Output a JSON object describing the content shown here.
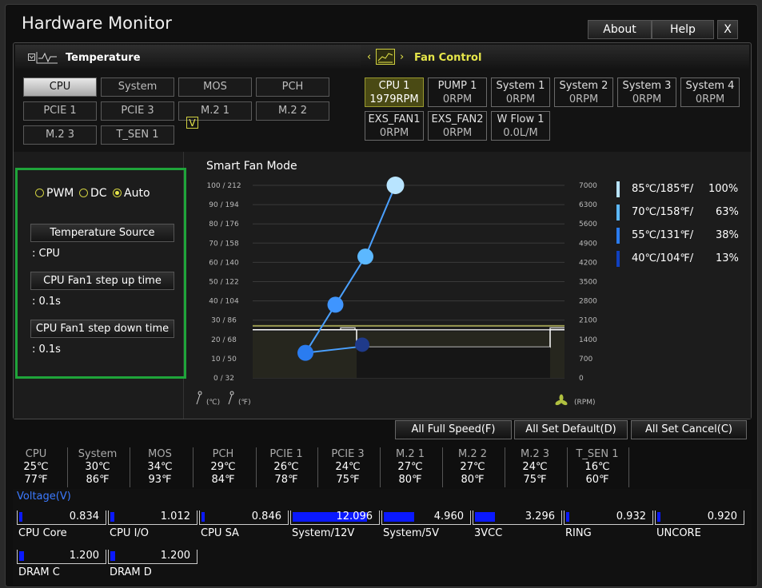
{
  "app": {
    "title": "Hardware Monitor",
    "buttons": {
      "about": "About",
      "help": "Help",
      "close": "X"
    }
  },
  "temperature_header": {
    "label": "Temperature"
  },
  "fan_header": {
    "label": "Fan Control"
  },
  "sources": [
    "CPU",
    "System",
    "MOS",
    "PCH",
    "PCIE 1",
    "PCIE 3",
    "M.2 1",
    "M.2 2",
    "M.2 3",
    "T_SEN 1"
  ],
  "fans": [
    {
      "name": "CPU 1",
      "value": "1979RPM"
    },
    {
      "name": "PUMP 1",
      "value": "0RPM"
    },
    {
      "name": "System 1",
      "value": "0RPM"
    },
    {
      "name": "System 2",
      "value": "0RPM"
    },
    {
      "name": "System 3",
      "value": "0RPM"
    },
    {
      "name": "System 4",
      "value": "0RPM"
    },
    {
      "name": "EXS_FAN1",
      "value": "0RPM"
    },
    {
      "name": "EXS_FAN2",
      "value": "0RPM"
    },
    {
      "name": "W Flow 1",
      "value": "0.0L/M"
    }
  ],
  "modes": {
    "pwm": "PWM",
    "dc": "DC",
    "auto": "Auto",
    "selected": "Auto"
  },
  "settings": {
    "temp_source_label": "Temperature Source",
    "temp_source_value": ": CPU",
    "step_up_label": "CPU Fan1 step up time",
    "step_up_value": ": 0.1s",
    "step_down_label": "CPU Fan1 step down time",
    "step_down_value": ": 0.1s"
  },
  "smart_fan": {
    "label": "Smart Fan Mode",
    "checked": true,
    "check_mark": "V"
  },
  "graph": {
    "left_ticks": [
      "100 / 212",
      "90 / 194",
      "80 / 176",
      "70 / 158",
      "60 / 140",
      "50 / 122",
      "40 / 104",
      "30 /  86",
      "20 /  68",
      "10 /  50",
      "0 /  32"
    ],
    "right_ticks": [
      "7000",
      "6300",
      "5600",
      "4900",
      "4200",
      "3500",
      "2800",
      "2100",
      "1400",
      "700",
      "0"
    ],
    "unit_c": "(℃)",
    "unit_f": "(℉)",
    "unit_rpm": "(RPM)",
    "points": [
      {
        "temp_c": 40,
        "pct": 13
      },
      {
        "temp_c": 55,
        "pct": 38
      },
      {
        "temp_c": 70,
        "pct": 63
      },
      {
        "temp_c": 85,
        "pct": 100
      }
    ]
  },
  "legend": [
    {
      "temp": "85℃/185℉/",
      "pct": "100%",
      "color": "#b8e4ff"
    },
    {
      "temp": "70℃/158℉/",
      "pct": "63%",
      "color": "#5cb8ff"
    },
    {
      "temp": "55℃/131℉/",
      "pct": "38%",
      "color": "#2a7cf0"
    },
    {
      "temp": "40℃/104℉/",
      "pct": "13%",
      "color": "#1040c0"
    }
  ],
  "actions": {
    "full_speed": "All Full Speed(F)",
    "set_default": "All Set Default(D)",
    "set_cancel": "All Set Cancel(C)"
  },
  "temps": [
    {
      "name": "CPU",
      "c": "25℃",
      "f": "77℉"
    },
    {
      "name": "System",
      "c": "30℃",
      "f": "86℉"
    },
    {
      "name": "MOS",
      "c": "34℃",
      "f": "93℉"
    },
    {
      "name": "PCH",
      "c": "29℃",
      "f": "84℉"
    },
    {
      "name": "PCIE 1",
      "c": "26℃",
      "f": "78℉"
    },
    {
      "name": "PCIE 3",
      "c": "24℃",
      "f": "75℉"
    },
    {
      "name": "M.2 1",
      "c": "27℃",
      "f": "80℉"
    },
    {
      "name": "M.2 2",
      "c": "27℃",
      "f": "80℉"
    },
    {
      "name": "M.2 3",
      "c": "24℃",
      "f": "75℉"
    },
    {
      "name": "T_SEN 1",
      "c": "16℃",
      "f": "60℉"
    }
  ],
  "voltage": {
    "title": "Voltage(V)",
    "items": [
      {
        "name": "CPU Core",
        "value": "0.834",
        "fill": 0.04
      },
      {
        "name": "CPU I/O",
        "value": "1.012",
        "fill": 0.05
      },
      {
        "name": "CPU SA",
        "value": "0.846",
        "fill": 0.04
      },
      {
        "name": "System/12V",
        "value": "12.096",
        "fill": 0.88
      },
      {
        "name": "System/5V",
        "value": "4.960",
        "fill": 0.36
      },
      {
        "name": "3VCC",
        "value": "3.296",
        "fill": 0.24
      },
      {
        "name": "RING",
        "value": "0.932",
        "fill": 0.04
      },
      {
        "name": "UNCORE",
        "value": "0.920",
        "fill": 0.04
      },
      {
        "name": "DRAM C",
        "value": "1.200",
        "fill": 0.06
      },
      {
        "name": "DRAM D",
        "value": "1.200",
        "fill": 0.06
      }
    ]
  },
  "colors": {
    "accent": "#e6e64a",
    "highlight_box": "#1fa43a",
    "voltage_fill": "#0a19ff",
    "voltage_title": "#3c7aff"
  }
}
